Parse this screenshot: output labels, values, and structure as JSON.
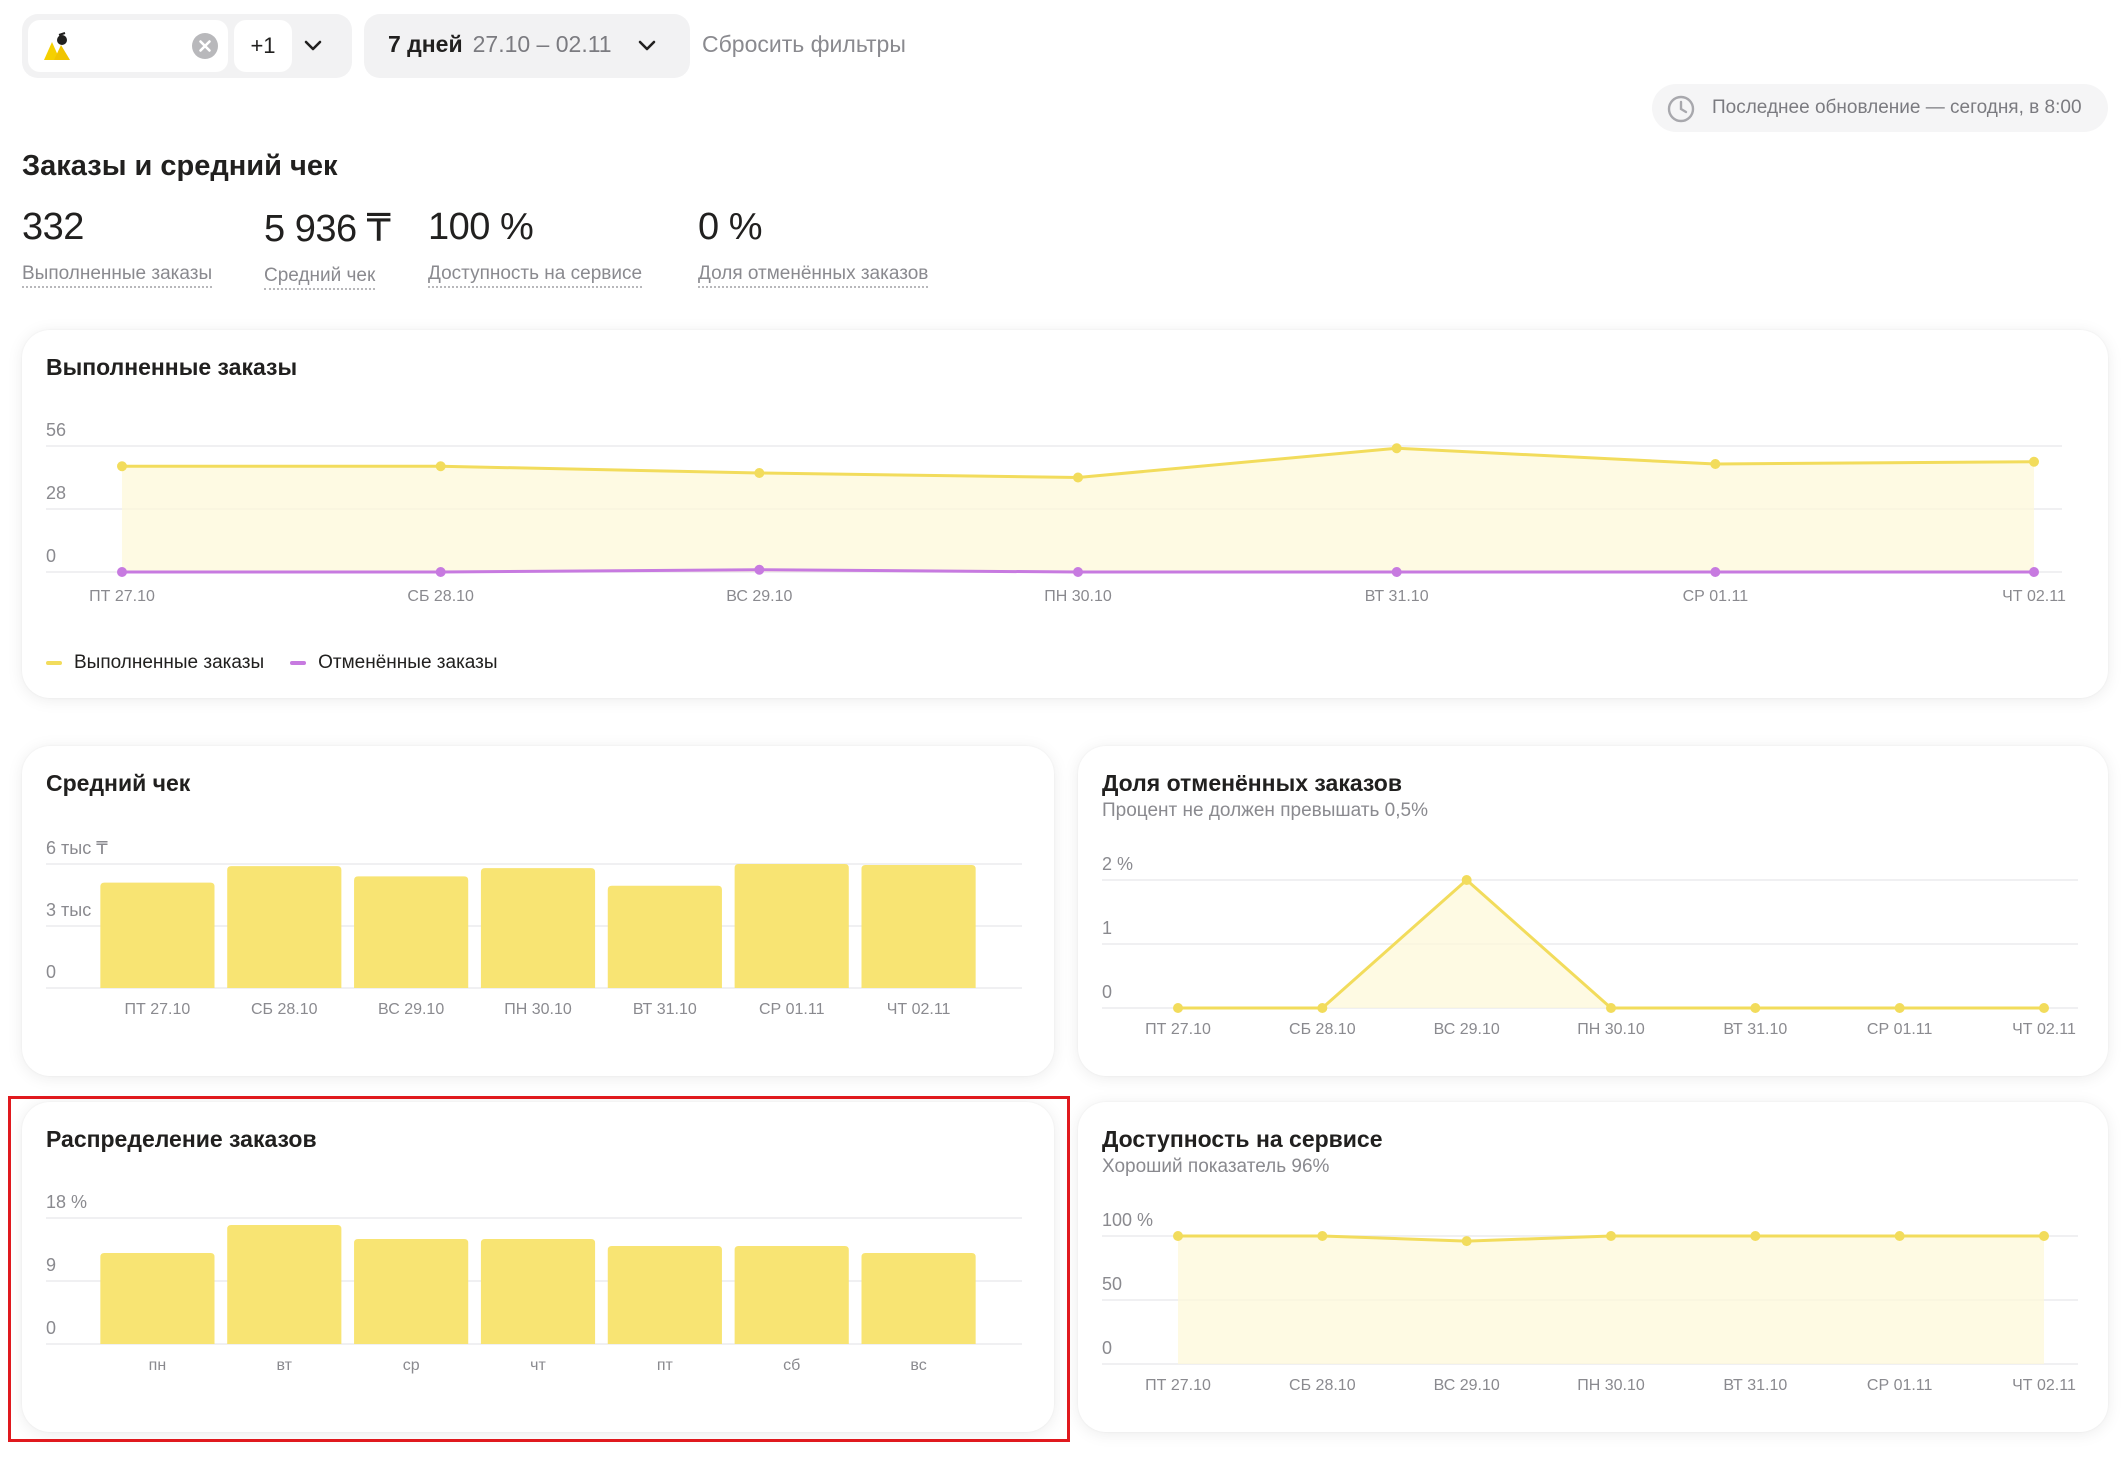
{
  "filters": {
    "store_extra_count": "+1",
    "period_days": "7 дней",
    "period_range": "27.10 – 02.11",
    "reset_label": "Сбросить фильтры",
    "last_update": "Последнее обновление — сегодня, в 8:00"
  },
  "summary": {
    "title": "Заказы и средний чек",
    "kpis": [
      {
        "value": "332",
        "label": "Выполненные заказы"
      },
      {
        "value": "5 936 ₸",
        "label": "Средний чек"
      },
      {
        "value": "100 %",
        "label": "Доступность на сервисе"
      },
      {
        "value": "0 %",
        "label": "Доля отменённых заказов"
      }
    ]
  },
  "colors": {
    "accent_yellow": "#f8e473",
    "line_yellow": "#f7e17a",
    "purple": "#c77ae0",
    "highlight_red": "#e0191e"
  },
  "cards": {
    "completed": {
      "title": "Выполненные заказы",
      "legend": [
        {
          "label": "Выполненные заказы",
          "color": "#f2dc5c"
        },
        {
          "label": "Отменённые заказы",
          "color": "#c77ae0"
        }
      ]
    },
    "avg_check": {
      "title": "Средний чек"
    },
    "cancel_share": {
      "title": "Доля отменённых заказов",
      "subtitle": "Процент не должен превышать 0,5%"
    },
    "distribution": {
      "title": "Распределение заказов"
    },
    "availability": {
      "title": "Доступность на сервисе",
      "subtitle": "Хороший показатель 96%"
    }
  },
  "chart_data": [
    {
      "type": "line",
      "title": "Выполненные заказы",
      "x": [
        "ПТ 27.10",
        "СБ 28.10",
        "ВС 29.10",
        "ПН 30.10",
        "ВТ 31.10",
        "СР 01.11",
        "ЧТ 02.11"
      ],
      "series": [
        {
          "name": "Выполненные заказы",
          "values": [
            47,
            47,
            44,
            42,
            55,
            48,
            49
          ]
        },
        {
          "name": "Отменённые заказы",
          "values": [
            0,
            0,
            1,
            0,
            0,
            0,
            0
          ]
        }
      ],
      "yticks": [
        "0",
        "28",
        "56"
      ],
      "ylim": [
        0,
        56
      ],
      "legend": "bottom-left",
      "grid": true
    },
    {
      "type": "bar",
      "title": "Средний чек",
      "categories": [
        "ПТ 27.10",
        "СБ 28.10",
        "ВС 29.10",
        "ПН 30.10",
        "ВТ 31.10",
        "СР 01.11",
        "ЧТ 02.11"
      ],
      "values": [
        5100,
        5900,
        5400,
        5800,
        4950,
        6000,
        5950
      ],
      "yticks": [
        "0",
        "3 тыс",
        "6 тыс ₸"
      ],
      "ylim": [
        0,
        6000
      ],
      "grid": true
    },
    {
      "type": "area",
      "title": "Доля отменённых заказов",
      "x": [
        "ПТ 27.10",
        "СБ 28.10",
        "ВС 29.10",
        "ПН 30.10",
        "ВТ 31.10",
        "СР 01.11",
        "ЧТ 02.11"
      ],
      "values": [
        0,
        0,
        2,
        0,
        0,
        0,
        0
      ],
      "yticks": [
        "0",
        "1",
        "2 %"
      ],
      "ylim": [
        0,
        2
      ],
      "grid": true
    },
    {
      "type": "bar",
      "title": "Распределение заказов",
      "categories": [
        "пн",
        "вт",
        "ср",
        "чт",
        "пт",
        "сб",
        "вс"
      ],
      "values": [
        13,
        17,
        15,
        15,
        14,
        14,
        13
      ],
      "yticks": [
        "0",
        "9",
        "18 %"
      ],
      "ylim": [
        0,
        18
      ],
      "grid": true
    },
    {
      "type": "area",
      "title": "Доступность на сервисе",
      "x": [
        "ПТ 27.10",
        "СБ 28.10",
        "ВС 29.10",
        "ПН 30.10",
        "ВТ 31.10",
        "СР 01.11",
        "ЧТ 02.11"
      ],
      "values": [
        100,
        100,
        96,
        100,
        100,
        100,
        100
      ],
      "yticks": [
        "0",
        "50",
        "100 %"
      ],
      "ylim": [
        0,
        100
      ],
      "grid": true
    }
  ]
}
